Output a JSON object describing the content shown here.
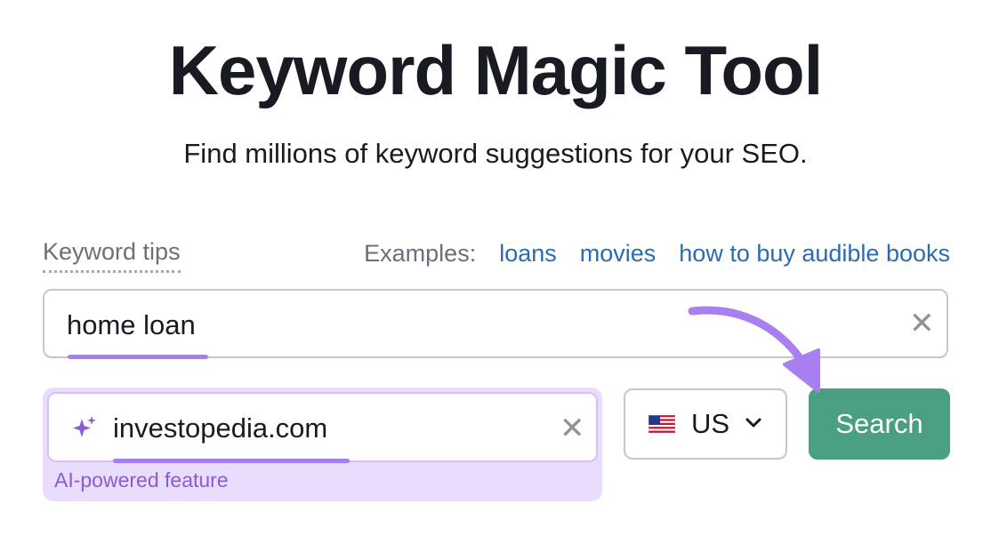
{
  "header": {
    "title": "Keyword Magic Tool",
    "subtitle": "Find millions of keyword suggestions for your SEO."
  },
  "tips": {
    "label": "Keyword tips"
  },
  "examples": {
    "label": "Examples:",
    "links": [
      "loans",
      "movies",
      "how to buy audible books"
    ]
  },
  "keyword_input": {
    "value": "home loan",
    "clear_icon": "close-icon"
  },
  "domain_input": {
    "value": "investopedia.com",
    "icon": "sparkle-icon",
    "clear_icon": "close-icon",
    "feature_label": "AI-powered feature"
  },
  "country_select": {
    "selected": "US",
    "flag": "us-flag-icon"
  },
  "search_button": {
    "label": "Search"
  },
  "colors": {
    "accent_purple": "#a87ef0",
    "search_green": "#4a9e82",
    "link_blue": "#2b6cb0"
  }
}
